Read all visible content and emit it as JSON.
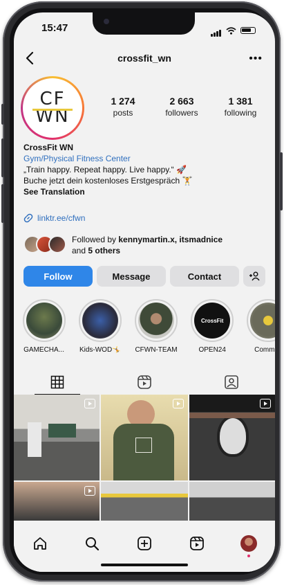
{
  "status": {
    "time": "15:47"
  },
  "header": {
    "username": "crossfit_wn"
  },
  "avatar": {
    "logo_line1": "CF",
    "logo_line2": "WN"
  },
  "stats": [
    {
      "value": "1 274",
      "label": "posts"
    },
    {
      "value": "2 663",
      "label": "followers"
    },
    {
      "value": "1 381",
      "label": "following"
    }
  ],
  "bio": {
    "name": "CrossFit WN",
    "category": "Gym/Physical Fitness Center",
    "line1": "„Train happy. Repeat happy. Live happy.“ 🚀",
    "line2": "Buche jetzt dein kostenloses Erstgespräch 🏋",
    "see_translation": "See Translation"
  },
  "link": {
    "text": "linktr.ee/cfwn"
  },
  "followed_by": {
    "prefix": "Followed by ",
    "names": "kennymartin.x, itsmadnice",
    "and": "and ",
    "others": "5 others"
  },
  "actions": {
    "follow": "Follow",
    "message": "Message",
    "contact": "Contact",
    "add_icon": "+👤"
  },
  "highlights": [
    {
      "label": "GAMECHA..."
    },
    {
      "label": "Kids-WOD🤸"
    },
    {
      "label": "CFWN-TEAM"
    },
    {
      "label": "OPEN24"
    },
    {
      "label": "Commun"
    }
  ],
  "highlight_badge": "CrossFit",
  "tabs": [
    "grid-icon",
    "reels-icon",
    "tagged-icon"
  ],
  "bottom_nav": [
    "home-icon",
    "search-icon",
    "create-icon",
    "reels-icon",
    "profile-icon"
  ],
  "colors": {
    "follow_blue": "#2f86e8",
    "link_blue": "#2f6fbe",
    "background": "#f2f2f2"
  }
}
